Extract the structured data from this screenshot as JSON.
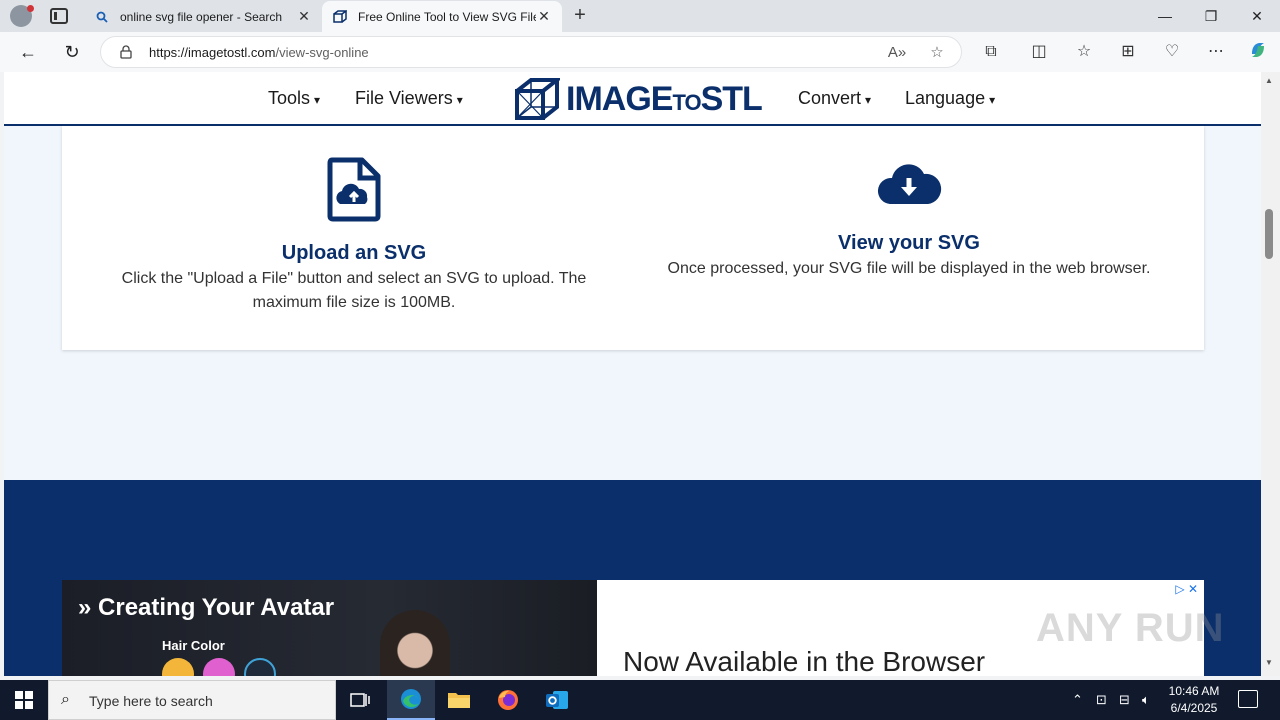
{
  "browser": {
    "tabs": [
      {
        "label": "online svg file opener - Search",
        "active": false
      },
      {
        "label": "Free Online Tool to View SVG File",
        "active": true
      }
    ],
    "url_domain": "https://imagetostl.com",
    "url_path": "/view-svg-online"
  },
  "site": {
    "nav": {
      "tools": "Tools",
      "file_viewers": "File Viewers",
      "convert": "Convert",
      "language": "Language",
      "arrow": "▾"
    },
    "logo": {
      "main": "IMAGE",
      "mid": "TO",
      "end": "STL"
    }
  },
  "features": [
    {
      "title": "Upload an SVG",
      "text": "Click the \"Upload a File\" button and select an SVG to upload. The maximum file size is 100MB."
    },
    {
      "title": "View your SVG",
      "text": "Once processed, your SVG file will be displayed in the web browser."
    }
  ],
  "ad": {
    "headline": "Creating Your Avatar",
    "headline_prefix": "»",
    "hair_label": "Hair Color",
    "right_text": "Now Available in the Browser",
    "swatch_colors": [
      "#f4b63a",
      "#e060d0",
      "#1e2a3a"
    ]
  },
  "watermark": "ANY RUN",
  "taskbar": {
    "search_placeholder": "Type here to search",
    "time": "10:46 AM",
    "date": "6/4/2025"
  },
  "colors": {
    "brand": "#0a2f6b",
    "page_bg": "#f0f6fc"
  }
}
